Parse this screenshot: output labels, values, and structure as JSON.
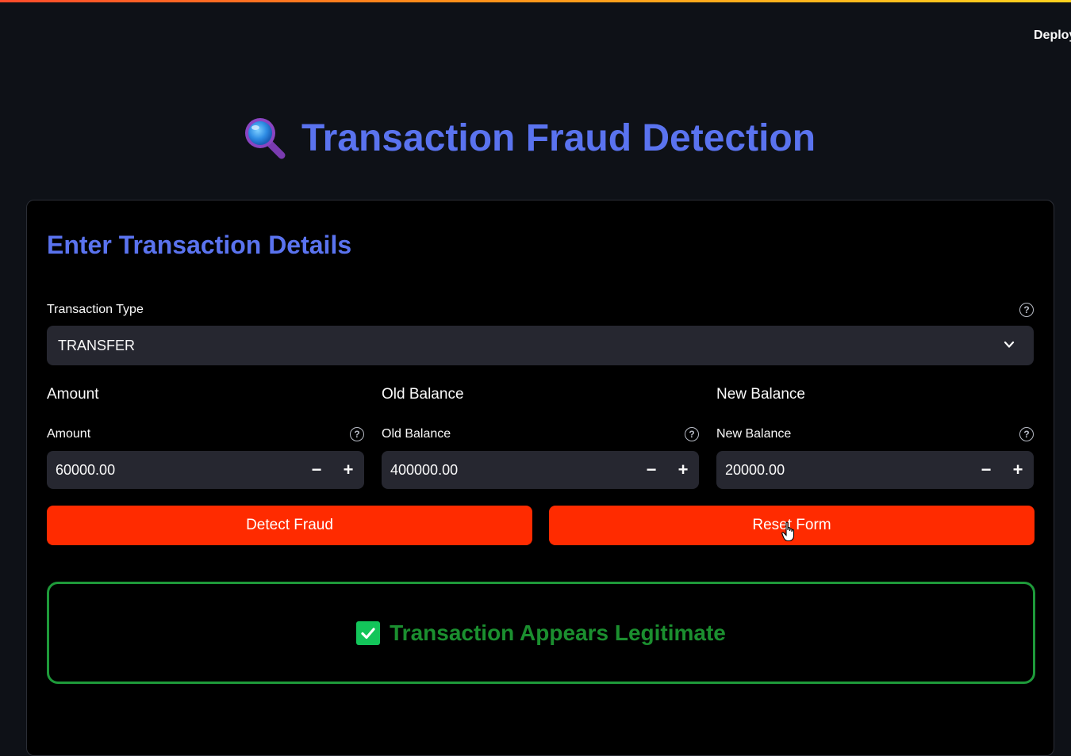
{
  "header": {
    "deploy_label": "Deploy"
  },
  "page": {
    "title": "Transaction Fraud Detection",
    "title_icon": "magnifying-glass-icon",
    "accent_color": "#5a73ef"
  },
  "form": {
    "section_title": "Enter Transaction Details",
    "transaction_type": {
      "label": "Transaction Type",
      "selected": "TRANSFER"
    },
    "columns": [
      {
        "heading": "Amount",
        "label": "Amount",
        "value": "60000.00"
      },
      {
        "heading": "Old Balance",
        "label": "Old Balance",
        "value": "400000.00"
      },
      {
        "heading": "New Balance",
        "label": "New Balance",
        "value": "20000.00"
      }
    ],
    "stepper_minus": "−",
    "stepper_plus": "+",
    "help_glyph": "?",
    "detect_button": "Detect Fraud",
    "reset_button": "Reset Form",
    "button_color": "#ff2b00"
  },
  "result": {
    "message": "Transaction Appears Legitimate",
    "status_color": "#1e9a3a",
    "icon": "check-mark-icon"
  }
}
